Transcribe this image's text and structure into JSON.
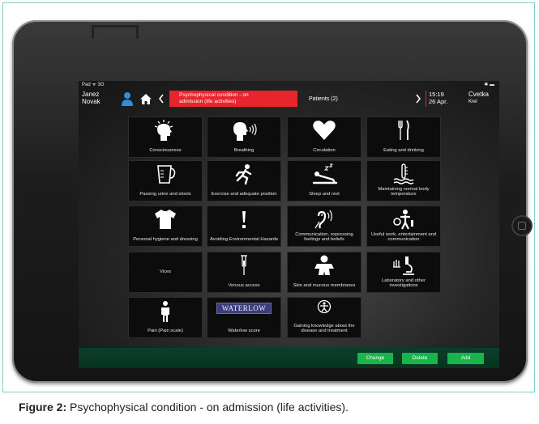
{
  "status": {
    "left": "Pad ᯤ 3G",
    "right": "✱ ▬"
  },
  "header": {
    "user_first": "Janez",
    "user_last": "Novak",
    "breadcrumb_line1": "Psychophysical condition - on",
    "breadcrumb_line2": "admission (life activities)",
    "patients": "Patients (2)",
    "time": "15:19",
    "date": "26 Apr.",
    "nurse_first": "Cvetka",
    "nurse_last": "Krel"
  },
  "tiles": [
    {
      "label": "Consciousness",
      "icon": "head-burst-icon"
    },
    {
      "label": "Breathing",
      "icon": "head-speaking-icon"
    },
    {
      "label": "Circulation",
      "icon": "heart-icon"
    },
    {
      "label": "Eating and drinking",
      "icon": "fork-knife-icon"
    },
    {
      "label": "Passing urine and stools",
      "icon": "measuring-jug-icon"
    },
    {
      "label": "Exercise and adequate position",
      "icon": "running-person-icon"
    },
    {
      "label": "Sleep and rest",
      "icon": "lying-person-icon"
    },
    {
      "label": "Maintaining normal body temperature",
      "icon": "thermometer-icon"
    },
    {
      "label": "Personal hygiene and dressing",
      "icon": "tshirt-icon"
    },
    {
      "label": "Avoiding Environmental Hazards",
      "icon": "exclamation-icon"
    },
    {
      "label": "Communication, expressing feelings and beliefs",
      "icon": "hearing-icon"
    },
    {
      "label": "Useful work, entertainment and communication",
      "icon": "people-activity-icon"
    },
    {
      "label": "Vices",
      "icon": ""
    },
    {
      "label": "Venous access",
      "icon": "iv-needle-icon"
    },
    {
      "label": "Skin and mucous membranes",
      "icon": "body-shape-icon"
    },
    {
      "label": "Laboratory and other investigations",
      "icon": "microscope-icon"
    },
    {
      "label": "Pain (Pain scale)",
      "icon": "standing-person-icon"
    },
    {
      "label": "Waterlow score",
      "icon": "waterlow-logo",
      "logo_text": "WATERLOW"
    },
    {
      "label": "Gaining knowledge about the disease and treatment",
      "icon": "figure-circle-icon"
    }
  ],
  "footer": {
    "change": "Change",
    "delete": "Delete",
    "add": "Add"
  },
  "caption": {
    "prefix": "Figure 2:",
    "text": " Psychophysical condition - on admission (life activities)."
  },
  "colors": {
    "accent_red": "#e8242c",
    "button_green": "#18b54a",
    "tile_bg": "#0c0c0c",
    "border_teal": "#7fd0c4"
  }
}
